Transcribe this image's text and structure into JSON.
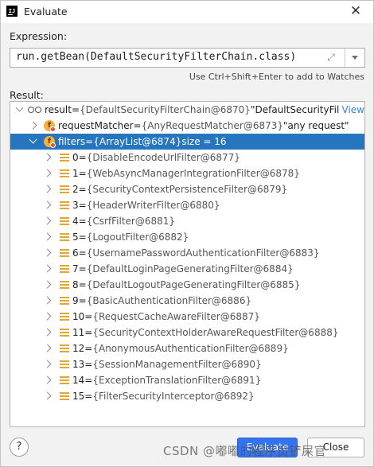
{
  "window": {
    "title": "Evaluate"
  },
  "expression": {
    "label": "Expression:",
    "value": "run.getBean(DefaultSecurityFilterChain.class)",
    "hint": "Use Ctrl+Shift+Enter to add to Watches"
  },
  "result": {
    "label": "Result:",
    "root": {
      "name": "result",
      "eq": " = ",
      "ref": "{DefaultSecurityFilterChain@6870}",
      "str": " \"DefaultSecurityFilter...",
      "view": "View"
    },
    "matcher": {
      "name": "requestMatcher",
      "eq": " = ",
      "ref": "{AnyRequestMatcher@6873}",
      "str": " \"any request\""
    },
    "filters": {
      "name": "filters",
      "eq": " = ",
      "ref": "{ArrayList@6874}",
      "size": "  size = 16"
    },
    "items": [
      {
        "idx": "0",
        "eq": " = ",
        "val": "{DisableEncodeUrlFilter@6877}"
      },
      {
        "idx": "1",
        "eq": " = ",
        "val": "{WebAsyncManagerIntegrationFilter@6878}"
      },
      {
        "idx": "2",
        "eq": " = ",
        "val": "{SecurityContextPersistenceFilter@6879}"
      },
      {
        "idx": "3",
        "eq": " = ",
        "val": "{HeaderWriterFilter@6880}"
      },
      {
        "idx": "4",
        "eq": " = ",
        "val": "{CsrfFilter@6881}"
      },
      {
        "idx": "5",
        "eq": " = ",
        "val": "{LogoutFilter@6882}"
      },
      {
        "idx": "6",
        "eq": " = ",
        "val": "{UsernamePasswordAuthenticationFilter@6883}"
      },
      {
        "idx": "7",
        "eq": " = ",
        "val": "{DefaultLoginPageGeneratingFilter@6884}"
      },
      {
        "idx": "8",
        "eq": " = ",
        "val": "{DefaultLogoutPageGeneratingFilter@6885}"
      },
      {
        "idx": "9",
        "eq": " = ",
        "val": "{BasicAuthenticationFilter@6886}"
      },
      {
        "idx": "10",
        "eq": " = ",
        "val": "{RequestCacheAwareFilter@6887}"
      },
      {
        "idx": "11",
        "eq": " = ",
        "val": "{SecurityContextHolderAwareRequestFilter@6888}"
      },
      {
        "idx": "12",
        "eq": " = ",
        "val": "{AnonymousAuthenticationFilter@6889}"
      },
      {
        "idx": "13",
        "eq": " = ",
        "val": "{SessionManagementFilter@6890}"
      },
      {
        "idx": "14",
        "eq": " = ",
        "val": "{ExceptionTranslationFilter@6891}"
      },
      {
        "idx": "15",
        "eq": " = ",
        "val": "{FilterSecurityInterceptor@6892}"
      }
    ]
  },
  "buttons": {
    "help": "?",
    "evaluate": "Evaluate",
    "close": "Close"
  },
  "watermark": "CSDN @嘟嘟的程序员铲屎官",
  "colors": {
    "selection": "#2675bf",
    "primary_button": "#3574f0",
    "field_icon": "#f4af3d",
    "list_icon": "#e3a72f",
    "link": "#3d82cc"
  }
}
